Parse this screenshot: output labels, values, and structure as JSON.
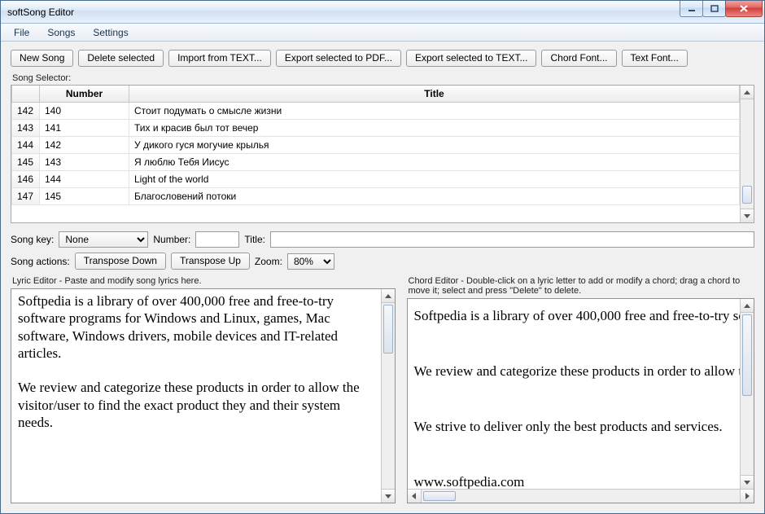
{
  "window": {
    "title": "softSong Editor"
  },
  "menubar": {
    "file": "File",
    "songs": "Songs",
    "settings": "Settings"
  },
  "toolbar": {
    "new_song": "New Song",
    "delete_selected": "Delete selected",
    "import_text": "Import from TEXT...",
    "export_pdf": "Export selected to PDF...",
    "export_text": "Export selected to TEXT...",
    "chord_font": "Chord Font...",
    "text_font": "Text Font..."
  },
  "selector": {
    "label": "Song Selector:",
    "columns": {
      "idx": "",
      "number": "Number",
      "title": "Title"
    },
    "rows": [
      {
        "idx": "142",
        "number": "140",
        "title": "Стоит подумать   о смысле жизни"
      },
      {
        "idx": "143",
        "number": "141",
        "title": "Тих и красив был тот вечер"
      },
      {
        "idx": "144",
        "number": "142",
        "title": "У дикого гуся могучие крылья"
      },
      {
        "idx": "145",
        "number": "143",
        "title": "Я люблю Тебя Иисус"
      },
      {
        "idx": "146",
        "number": "144",
        "title": "Light of the world"
      },
      {
        "idx": "147",
        "number": "145",
        "title": "Благословений потоки"
      }
    ]
  },
  "form": {
    "song_key_label": "Song key:",
    "song_key_value": "None",
    "number_label": "Number:",
    "number_value": "",
    "title_label": "Title:",
    "title_value": "",
    "actions_label": "Song actions:",
    "transpose_down": "Transpose Down",
    "transpose_up": "Transpose Up",
    "zoom_label": "Zoom:",
    "zoom_value": "80%"
  },
  "lyric_editor": {
    "label": "Lyric Editor - Paste and modify song lyrics here.",
    "text": "Softpedia is a library of over 400,000 free and free-to-try software programs for Windows and Linux, games, Mac software, Windows drivers, mobile devices and IT-related articles.\n\nWe review and categorize these products in order to allow the visitor/user to find the exact product they and their system needs."
  },
  "chord_editor": {
    "label": "Chord Editor - Double-click on a lyric letter to add or modify a chord; drag a chord to move it; select and press \"Delete\" to delete.",
    "text": "Softpedia is a library of over 400,000 free and free-to-try software programs for Windows and Linux, games, Mac software, Windows drivers, mobile devices and IT-related articles.\n\nWe review and categorize these products in order to allow the visitor/user to find the exact product they and their system needs.\n\nWe strive to deliver only the best products and services.\n\nwww.softpedia.com"
  }
}
